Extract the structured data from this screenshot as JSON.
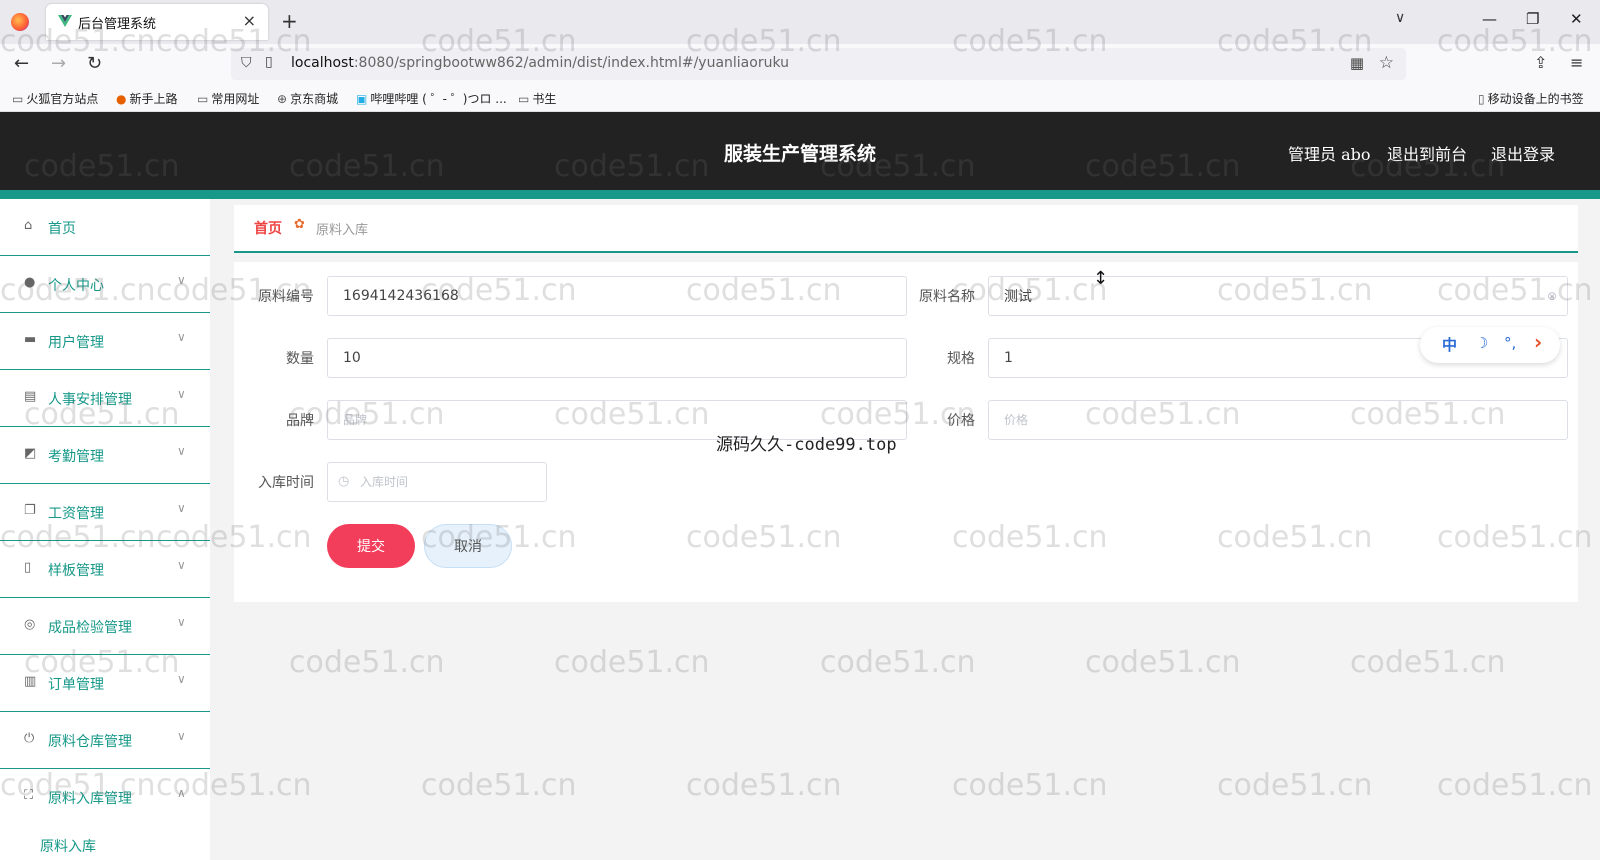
{
  "browser": {
    "tab_title": "后台管理系统",
    "tab_close": "×",
    "new_tab": "+",
    "tab_list": "∨",
    "window_controls": [
      "—",
      "❐",
      "✕"
    ],
    "url_host": "localhost",
    "url_rest": ":8080/springbootww862/admin/dist/index.html#/yuanliaoruku",
    "bookmarks": [
      "火狐官方站点",
      "新手上路",
      "常用网址",
      "京东商城",
      "哔哩哔哩 ( ゜- ゜)つロ ...",
      "书生"
    ],
    "mobile_bookmarks": "移动设备上的书签"
  },
  "header": {
    "title": "服装生产管理系统",
    "user": "管理员 abo",
    "to_front": "退出到前台",
    "logout": "退出登录"
  },
  "sidebar": {
    "items": [
      {
        "label": "首页",
        "icon": "home-icon"
      },
      {
        "label": "个人中心",
        "icon": "user-icon"
      },
      {
        "label": "用户管理",
        "icon": "briefcase-icon"
      },
      {
        "label": "人事安排管理",
        "icon": "clipboard-icon"
      },
      {
        "label": "考勤管理",
        "icon": "chart-icon"
      },
      {
        "label": "工资管理",
        "icon": "copy-icon"
      },
      {
        "label": "样板管理",
        "icon": "phone-icon"
      },
      {
        "label": "成品检验管理",
        "icon": "compass-icon"
      },
      {
        "label": "订单管理",
        "icon": "book-icon"
      },
      {
        "label": "原料仓库管理",
        "icon": "power-icon"
      },
      {
        "label": "原料入库管理",
        "icon": "fullscreen-icon"
      }
    ],
    "sub_item": "原料入库"
  },
  "breadcrumb": {
    "home": "首页",
    "current": "原料入库"
  },
  "form": {
    "code_label": "原料编号",
    "code_value": "1694142436168",
    "name_label": "原料名称",
    "name_value": "测试",
    "qty_label": "数量",
    "qty_value": "10",
    "spec_label": "规格",
    "spec_value": "1",
    "brand_label": "品牌",
    "brand_placeholder": "品牌",
    "price_label": "价格",
    "price_placeholder": "价格",
    "time_label": "入库时间",
    "time_placeholder": "入库时间",
    "submit": "提交",
    "cancel": "取消"
  },
  "ime_bar": {
    "mode": "中",
    "moon": "☽",
    "dots": "°,",
    "arrow": "›"
  },
  "overlay_text": "源码久久-code99.top",
  "watermark": "code51.cn",
  "colors": {
    "accent": "#179888",
    "header_bg": "#222222",
    "submit": "#f23e5b",
    "cancel": "#e6f1fb"
  }
}
